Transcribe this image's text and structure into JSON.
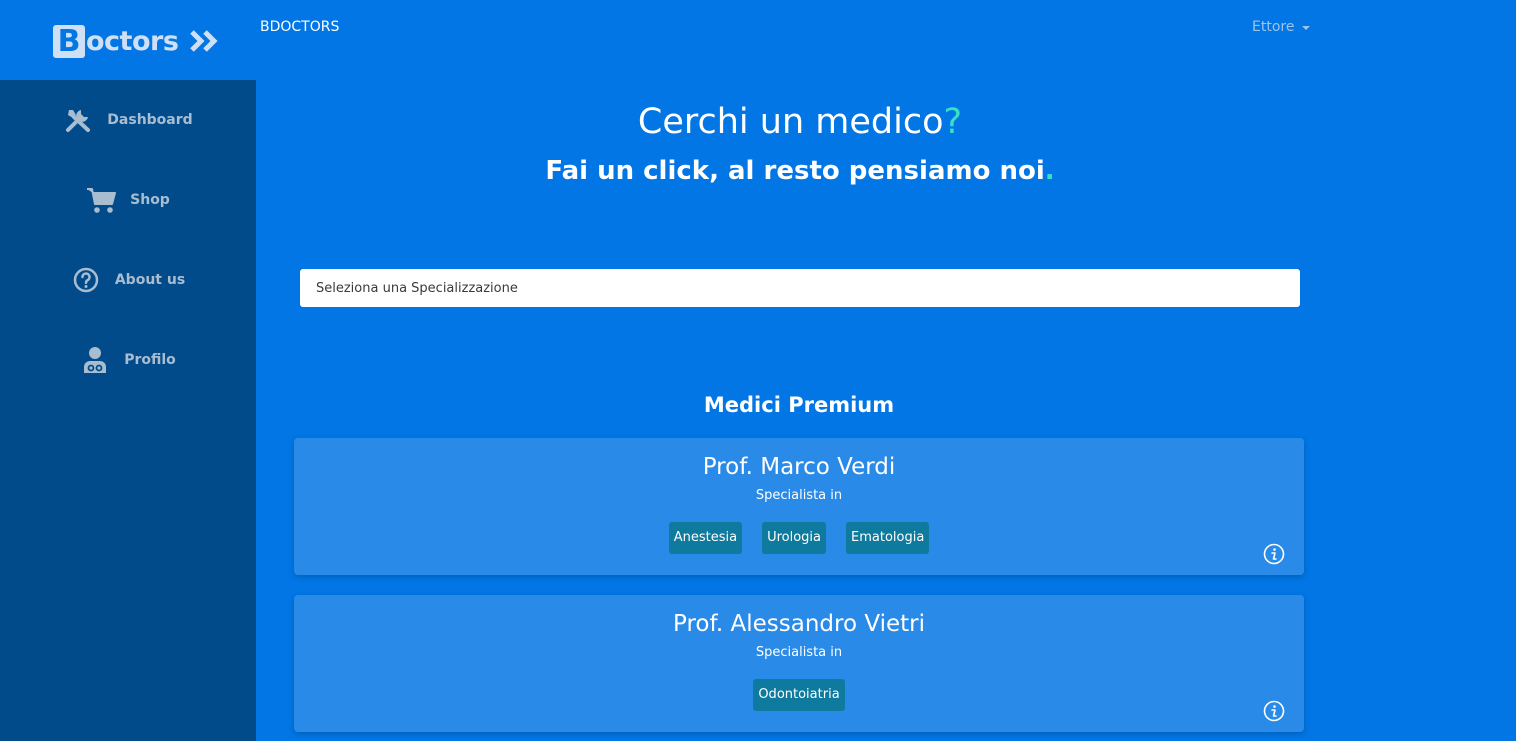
{
  "brand": {
    "logo_letter": "B",
    "logo_text": "octors",
    "nav_link": "BDOCTORS"
  },
  "user": {
    "name": "Ettore"
  },
  "sidebar": {
    "items": [
      {
        "label": "Dashboard",
        "icon": "tools-icon"
      },
      {
        "label": "Shop",
        "icon": "cart-icon"
      },
      {
        "label": "About us",
        "icon": "question-circle-icon"
      },
      {
        "label": "Profilo",
        "icon": "user-doctor-icon"
      }
    ]
  },
  "hero": {
    "title": "Cerchi un medico",
    "title_mark": "?",
    "subtitle": "Fai un click, al resto pensiamo noi",
    "subtitle_mark": "."
  },
  "search": {
    "selected": "Seleziona una Specializzazione"
  },
  "premium": {
    "title": "Medici Premium",
    "doctors": [
      {
        "name": "Prof. Marco Verdi",
        "spec_label": "Specialista in",
        "tags": [
          "Anestesia",
          "Urologia",
          "Ematologia"
        ]
      },
      {
        "name": "Prof. Alessandro Vietri",
        "spec_label": "Specialista in",
        "tags": [
          "Odontoiatria"
        ]
      }
    ]
  },
  "colors": {
    "primary": "#0176e4",
    "sidebar": "#024b8a",
    "card": "#2a8ae8",
    "tag": "#0e7a9e",
    "accent": "#39e0c6"
  }
}
